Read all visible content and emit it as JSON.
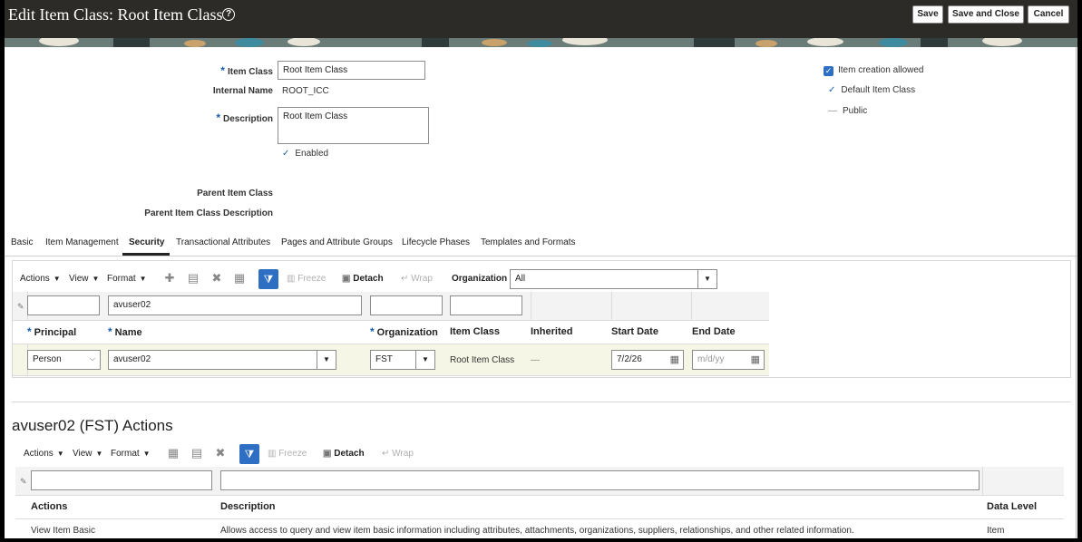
{
  "header": {
    "title": "Edit Item Class: Root Item Class",
    "help_icon": "question-circle-icon",
    "buttons": {
      "save": "Save",
      "save_close": "Save and Close",
      "cancel": "Cancel"
    }
  },
  "form": {
    "item_class_label": "Item Class",
    "item_class_value": "Root Item Class",
    "internal_name_label": "Internal Name",
    "internal_name_value": "ROOT_ICC",
    "description_label": "Description",
    "description_value": "Root Item Class",
    "enabled_label": "Enabled",
    "parent_item_class_label": "Parent Item Class",
    "parent_item_class_desc_label": "Parent Item Class Description",
    "item_creation_allowed_label": "Item creation allowed",
    "item_creation_allowed": true,
    "default_item_class_label": "Default Item Class",
    "public_label": "Public"
  },
  "tabs": [
    {
      "label": "Basic"
    },
    {
      "label": "Item Management"
    },
    {
      "label": "Security",
      "active": true
    },
    {
      "label": "Transactional Attributes"
    },
    {
      "label": "Pages and Attribute Groups"
    },
    {
      "label": "Lifecycle Phases"
    },
    {
      "label": "Templates and Formats"
    }
  ],
  "security_table": {
    "toolbar": {
      "actions": "Actions",
      "view": "View",
      "format": "Format",
      "freeze": "Freeze",
      "detach": "Detach",
      "wrap": "Wrap",
      "organization_label": "Organization",
      "organization_value": "All"
    },
    "filter": {
      "principal": "",
      "name": "avuser02",
      "organization": "",
      "item_class": ""
    },
    "columns": {
      "principal": "Principal",
      "name": "Name",
      "organization": "Organization",
      "item_class": "Item Class",
      "inherited": "Inherited",
      "start_date": "Start Date",
      "end_date": "End Date"
    },
    "rows": [
      {
        "principal": "Person",
        "name": "avuser02",
        "organization": "FST",
        "item_class": "Root Item Class",
        "inherited": "—",
        "start_date": "7/2/26",
        "end_date_placeholder": "m/d/yy"
      }
    ]
  },
  "actions_section": {
    "title": "avuser02 (FST) Actions",
    "toolbar": {
      "actions": "Actions",
      "view": "View",
      "format": "Format",
      "freeze": "Freeze",
      "detach": "Detach",
      "wrap": "Wrap"
    },
    "columns": {
      "actions": "Actions",
      "description": "Description",
      "data_level": "Data Level"
    },
    "rows": [
      {
        "action": "View Item Basic",
        "description": "Allows access to query and view item basic information including attributes, attachments, organizations, suppliers, relationships, and other related information.",
        "data_level": "Item"
      }
    ]
  }
}
